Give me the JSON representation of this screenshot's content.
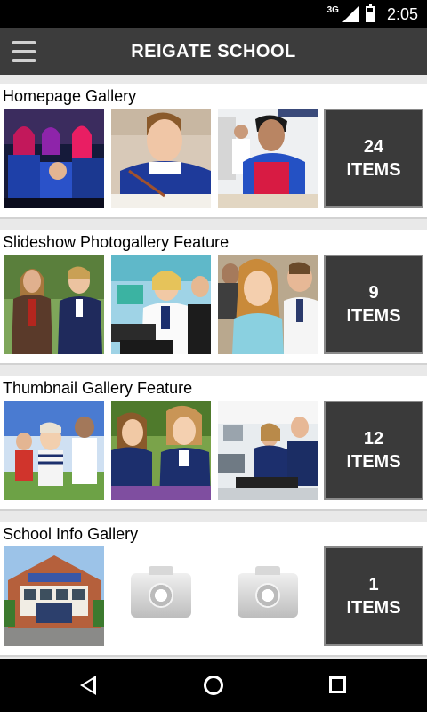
{
  "status_bar": {
    "network": "3G",
    "time": "2:05"
  },
  "app_bar": {
    "title": "REIGATE SCHOOL",
    "menu_icon": "hamburger-menu-icon"
  },
  "galleries": [
    {
      "title": "Homepage Gallery",
      "count": "24",
      "unit": "ITEMS"
    },
    {
      "title": "Slideshow Photogallery Feature",
      "count": "9",
      "unit": "ITEMS"
    },
    {
      "title": "Thumbnail Gallery Feature",
      "count": "12",
      "unit": "ITEMS"
    },
    {
      "title": "School Info Gallery",
      "count": "1",
      "unit": "ITEMS"
    }
  ],
  "nav_bar": {
    "back_icon": "back-icon",
    "home_icon": "home-icon",
    "recent_icon": "recent-apps-icon"
  }
}
